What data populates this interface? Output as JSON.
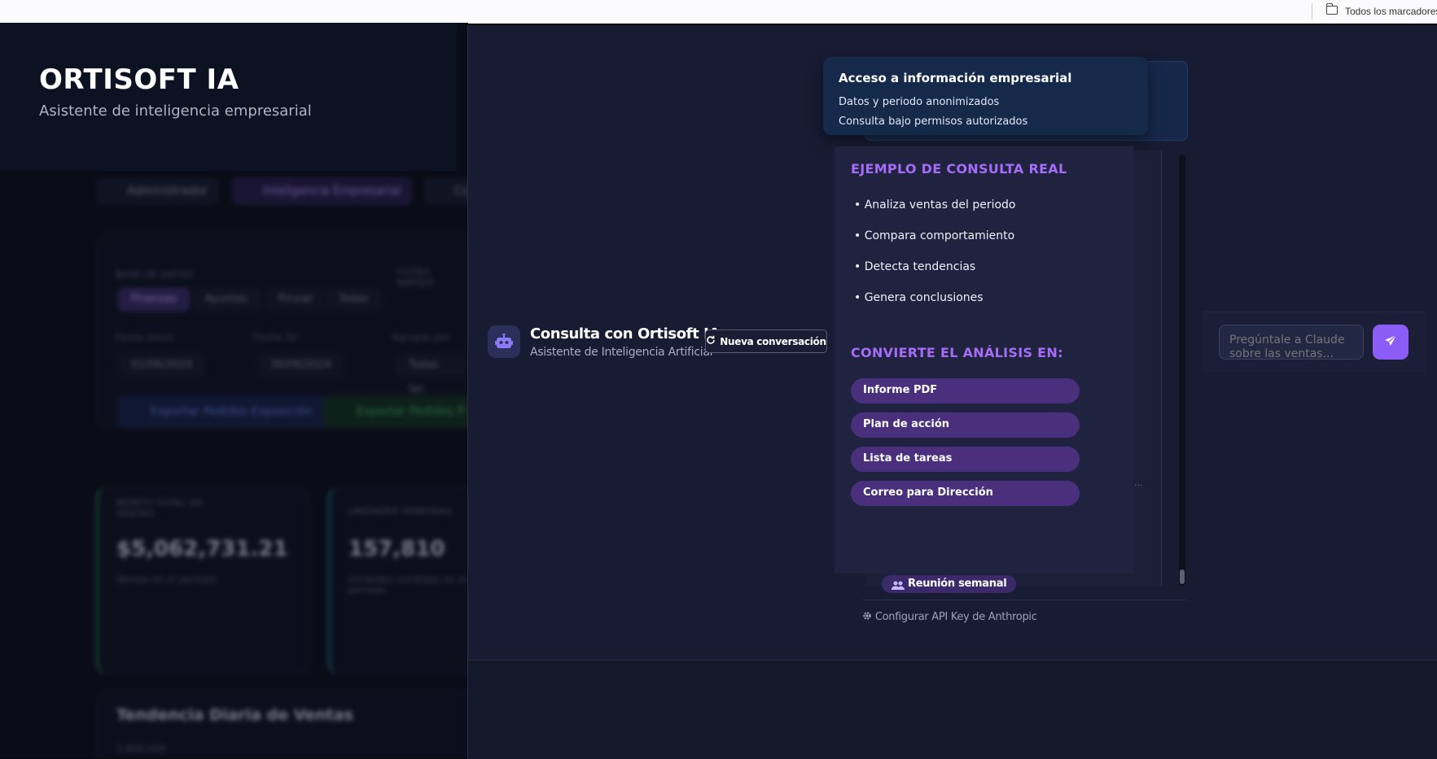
{
  "browser": {
    "bookmarks_label": "Todos los marcadores"
  },
  "brand": {
    "title": "ORTISOFT IA",
    "subtitle": "Asistente de inteligencia empresarial"
  },
  "chat": {
    "title": "Consulta con Ortisoft IA",
    "subtitle": "Asistente de Inteligencia Artificial",
    "new_conversation": "Nueva conversación",
    "input_placeholder": "Pregúntale a Claude sobre las ventas...",
    "meeting_chip": "Reunión semanal",
    "config_link": "Configurar API Key de Anthropic",
    "ellipsis": "...",
    "icons": {
      "bot": "robot-icon",
      "refresh": "refresh-icon",
      "send": "paper-plane-icon",
      "users": "users-icon",
      "gear": "gear-icon"
    }
  },
  "tooltip": {
    "title": "Acceso a información empresarial",
    "line1": "Datos y periodo anonimizados",
    "line2": "Consulta bajo permisos autorizados"
  },
  "example": {
    "heading": "EJEMPLO DE CONSULTA REAL",
    "bullets": [
      "• Analiza ventas del periodo",
      "• Compara comportamiento",
      "• Detecta tendencias",
      "• Genera conclusiones"
    ],
    "convert_heading": "CONVIERTE EL ANÁLISIS EN:",
    "outputs": [
      "Informe PDF",
      "Plan de acción",
      "Lista de tareas",
      "Correo para Dirección"
    ]
  },
  "background": {
    "tabs": [
      "Administrador",
      "Inteligencia Empresarial",
      "Co"
    ],
    "base_label": "BASE DE DATOS",
    "filter_label": "FILTRO RAPIDO",
    "periods": [
      "Finanzas",
      "Ayuntas",
      "Finvial",
      "Todas"
    ],
    "fecha_inicio_label": "Fecha inicio",
    "fecha_fin_label": "Fecha fin",
    "agrupar_label": "Agrupar por",
    "fecha_inicio": "01/06/2024",
    "fecha_fin": "30/06/2024",
    "agrupar_value": "Todas las",
    "export_a": "Exportar Pedidos Exposición",
    "export_b": "Exportar Pedidos Fi",
    "metric1_label": "MONTO TOTAL DE VENTAS",
    "metric1_value": "$5,062,731.21",
    "metric1_note": "Ventas en el periodo",
    "metric2_label": "UNIDADES VENDIDAS",
    "metric2_value": "157,810",
    "metric2_note": "Unidades vendidas en el periodo",
    "trend_title": "Tendencia Diaria de Ventas",
    "trend_sub": "1,600,000"
  },
  "colors": {
    "accent": "#8b5cf6",
    "heading": "#a66cf7",
    "pill": "#4a2f7d",
    "tooltip": "#15294b"
  }
}
